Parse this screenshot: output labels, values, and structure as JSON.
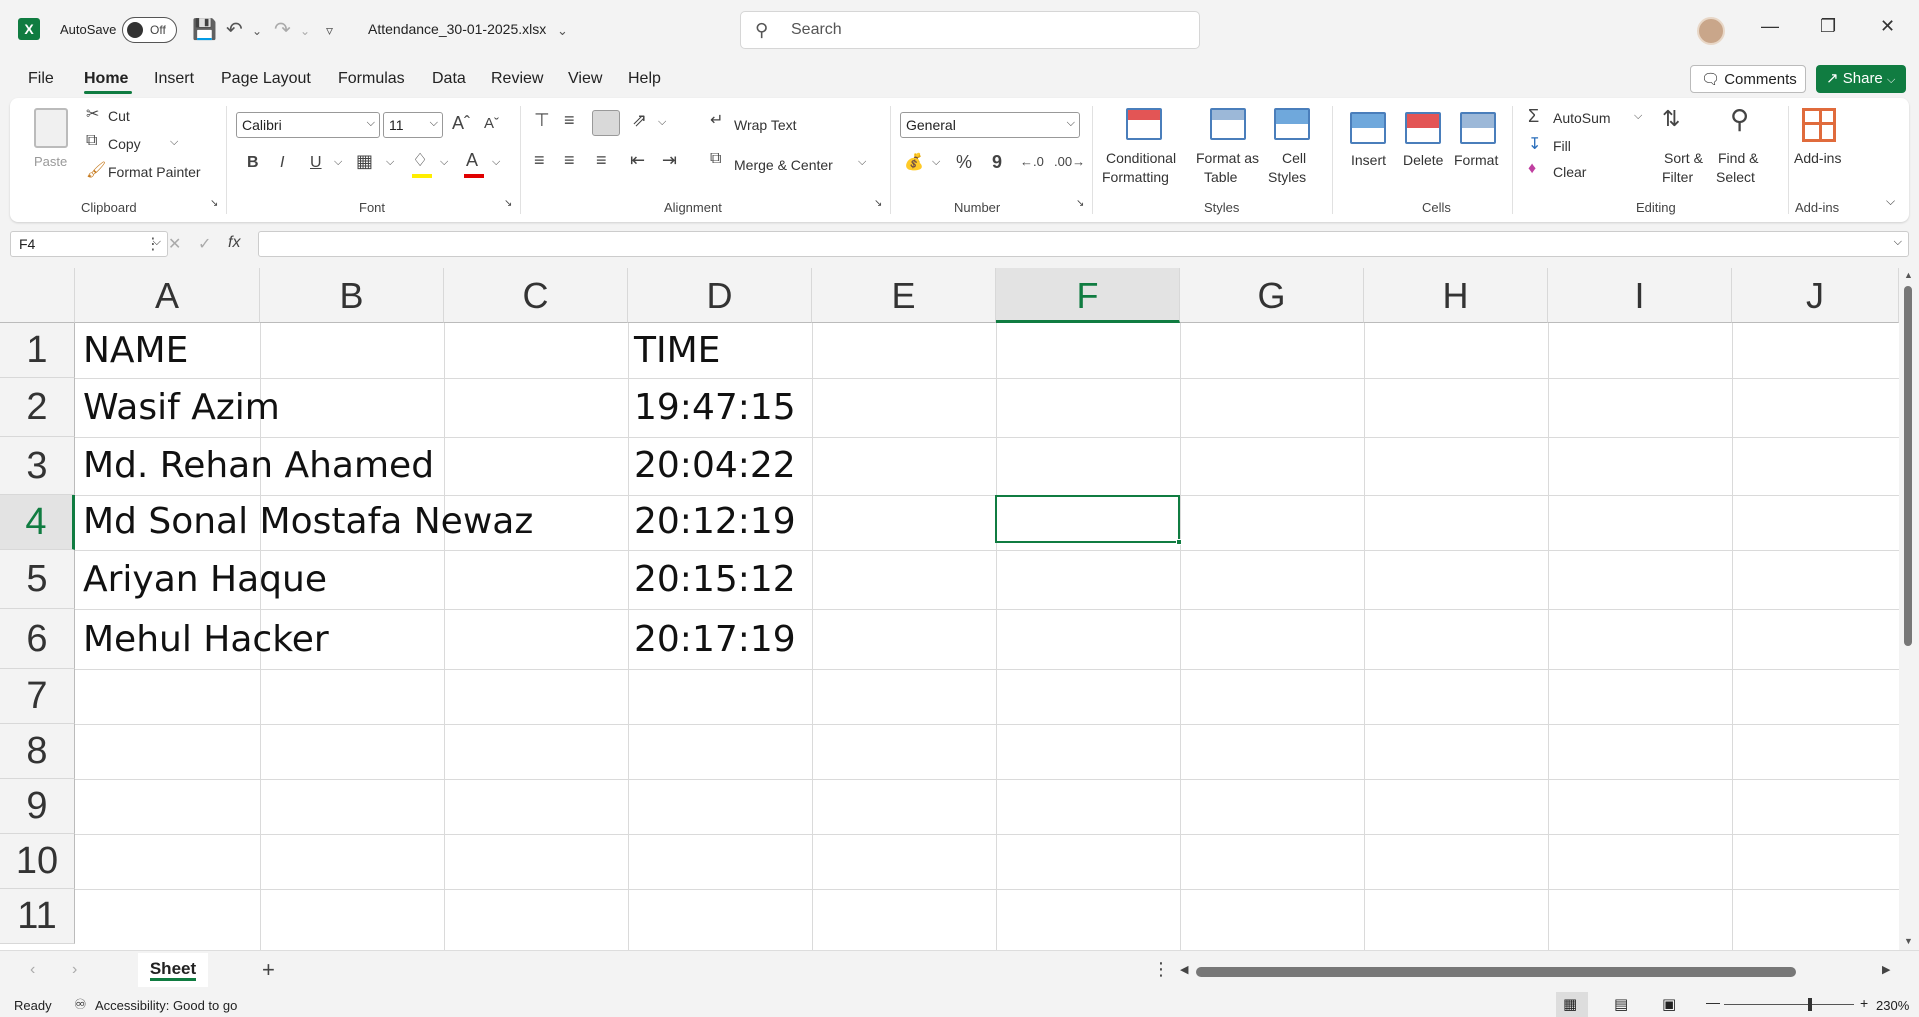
{
  "app": {
    "autosave_label": "AutoSave",
    "autosave_state": "Off",
    "file_name": "Attendance_30-01-2025.xlsx",
    "search_placeholder": "Search"
  },
  "tabs": [
    "File",
    "Home",
    "Insert",
    "Page Layout",
    "Formulas",
    "Data",
    "Review",
    "View",
    "Help"
  ],
  "actions": {
    "comments": "Comments",
    "share": "Share"
  },
  "ribbon": {
    "clipboard": {
      "paste": "Paste",
      "cut": "Cut",
      "copy": "Copy",
      "format_painter": "Format Painter",
      "group": "Clipboard"
    },
    "font": {
      "name": "Calibri",
      "size": "11",
      "bold": "B",
      "italic": "I",
      "underline": "U",
      "group": "Font"
    },
    "alignment": {
      "wrap_text": "Wrap Text",
      "merge_center": "Merge & Center",
      "group": "Alignment"
    },
    "number": {
      "format": "General",
      "percent": "%",
      "comma": "9",
      "group": "Number"
    },
    "styles": {
      "conditional_1": "Conditional",
      "conditional_2": "Formatting",
      "format_table_1": "Format as",
      "format_table_2": "Table",
      "cell_styles_1": "Cell",
      "cell_styles_2": "Styles",
      "group": "Styles"
    },
    "cells": {
      "insert": "Insert",
      "delete": "Delete",
      "format": "Format",
      "group": "Cells"
    },
    "editing": {
      "autosum": "AutoSum",
      "fill": "Fill",
      "clear": "Clear",
      "sort_1": "Sort &",
      "sort_2": "Filter",
      "find_1": "Find &",
      "find_2": "Select",
      "group": "Editing"
    },
    "addins": {
      "label": "Add-ins",
      "group": "Add-ins"
    }
  },
  "formula_bar": {
    "name_box": "F4",
    "fx": "fx",
    "content": ""
  },
  "grid": {
    "columns": [
      "A",
      "B",
      "C",
      "D",
      "E",
      "F",
      "G",
      "H",
      "I",
      "J"
    ],
    "rows": [
      "1",
      "2",
      "3",
      "4",
      "5",
      "6",
      "7",
      "8",
      "9",
      "10",
      "11"
    ],
    "selected_cell": "F4",
    "cells": {
      "A1": "NAME",
      "D1": "TIME",
      "A2": "Wasif Azim",
      "D2": "19:47:15",
      "A3": "Md. Rehan Ahamed",
      "D3": "20:04:22",
      "A4": "Md Sonal Mostafa Newaz",
      "D4": "20:12:19",
      "A5": "Ariyan Haque",
      "D5": "20:15:12",
      "A6": "Mehul Hacker",
      "D6": "20:17:19"
    }
  },
  "sheets": {
    "active": "Sheet",
    "add": "+"
  },
  "status": {
    "ready": "Ready",
    "accessibility": "Accessibility: Good to go",
    "zoom": "230%"
  }
}
